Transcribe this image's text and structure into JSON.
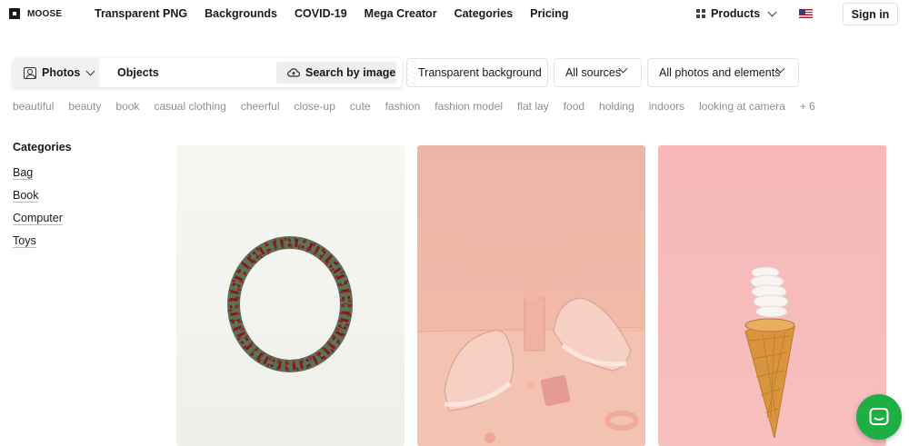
{
  "header": {
    "logo_text": "MOOSE",
    "nav": [
      "Transparent PNG",
      "Backgrounds",
      "COVID-19",
      "Mega Creator",
      "Categories",
      "Pricing"
    ],
    "products_label": "Products",
    "flag": "us-flag-icon",
    "signin_label": "Sign in"
  },
  "search": {
    "type_label": "Photos",
    "query": "Objects",
    "search_by_image_label": "Search by image"
  },
  "filters": {
    "transparent": "Transparent background",
    "sources": "All sources",
    "elements": "All photos and elements"
  },
  "tags": [
    "beautiful",
    "beauty",
    "book",
    "casual clothing",
    "cheerful",
    "close-up",
    "cute",
    "fashion",
    "fashion model",
    "flat lay",
    "food",
    "holding",
    "indoors",
    "looking at camera",
    "+ 6"
  ],
  "categories": {
    "title": "Categories",
    "items": [
      "Bag",
      "Book",
      "Computer",
      "Toys"
    ]
  },
  "images": [
    "wreath-photo",
    "sneakers-photo",
    "ice-cream-cone-bulb-photo"
  ],
  "colors": {
    "chat": "#1fae44",
    "tag_text": "#8e8e8e"
  }
}
